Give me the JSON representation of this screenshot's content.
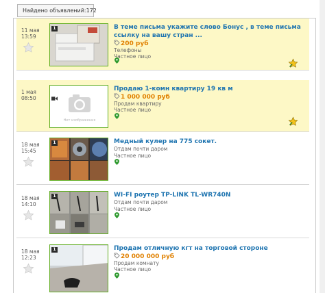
{
  "header": {
    "count_label": "Найдено объявлений:172"
  },
  "listings": [
    {
      "date": "11 мая",
      "time": "13:59",
      "title_line1": "В теме письма укажите слово Бонус , в теме письма",
      "title_line2": "ссылку на вашу стран ...",
      "price": "200 руб",
      "category": "Телефоны",
      "seller": "Частное лицо",
      "photo_count": "1",
      "vip": true,
      "has_photo": true
    },
    {
      "date": "1 мая",
      "time": "08:50",
      "title_line1": "Продаю 1-комн квартиру 19 кв м",
      "price": "1 000 000 руб",
      "category": "Продам квартиру",
      "seller": "Частное лицо",
      "photo_count": "",
      "vip": true,
      "has_photo": false,
      "no_image_text": "Нет изображения"
    },
    {
      "date": "18 мая",
      "time": "15:45",
      "title_line1": "Медный кулер на 775 сокет.",
      "price": "",
      "category": "Отдам почти даром",
      "seller": "Частное лицо",
      "photo_count": "1",
      "vip": false,
      "has_photo": true
    },
    {
      "date": "18 мая",
      "time": "14:10",
      "title_line1": "WI-FI роутер TP-LINK TL-WR740N",
      "price": "",
      "category": "Отдам почти даром",
      "seller": "Частное лицо",
      "photo_count": "1",
      "vip": false,
      "has_photo": true
    },
    {
      "date": "18 мая",
      "time": "12:23",
      "title_line1": "Продам отличную кгт на торговой стороне",
      "price": "20 000 000 руб",
      "category": "Продам комнату",
      "seller": "Частное лицо",
      "photo_count": "1",
      "vip": false,
      "has_photo": true
    }
  ],
  "colors": {
    "vip_bg": "#fdf8c6",
    "title": "#1e74b0",
    "price": "#e08000",
    "thumb_border": "#60ad1f"
  }
}
